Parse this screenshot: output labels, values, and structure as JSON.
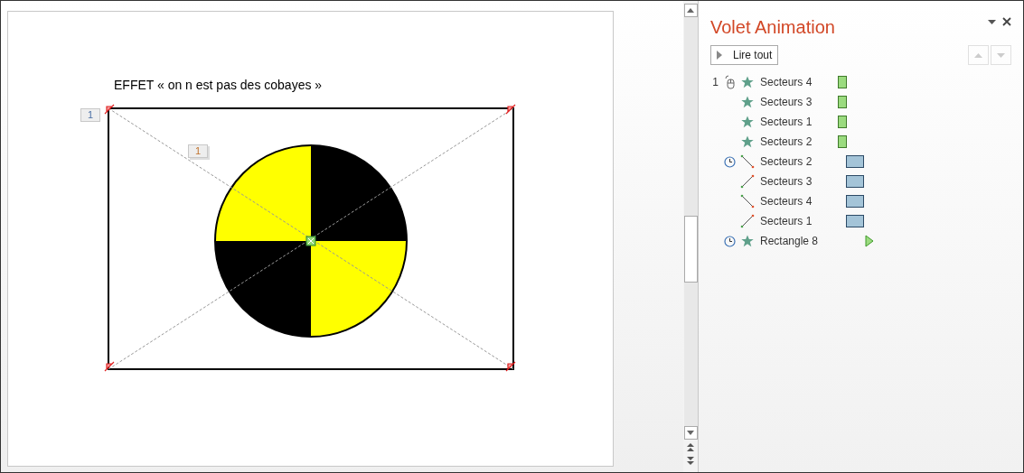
{
  "slide": {
    "title": "EFFET  « on n est pas des cobayes »",
    "trigger_badge": "1",
    "effect_badge": "1"
  },
  "pane": {
    "title": "Volet Animation",
    "play_button": "Lire tout",
    "items": [
      {
        "number": "1",
        "trigger": {
          "kind": "click"
        },
        "effect": {
          "kind": "emphasis"
        },
        "name": "Secteurs 4",
        "timing": {
          "kind": "short"
        }
      },
      {
        "effect": {
          "kind": "emphasis"
        },
        "name": "Secteurs 3",
        "timing": {
          "kind": "short"
        }
      },
      {
        "effect": {
          "kind": "emphasis"
        },
        "name": "Secteurs 1",
        "timing": {
          "kind": "short"
        }
      },
      {
        "effect": {
          "kind": "emphasis"
        },
        "name": "Secteurs 2",
        "timing": {
          "kind": "short"
        }
      },
      {
        "trigger": {
          "kind": "clock"
        },
        "effect": {
          "kind": "path-down"
        },
        "name": "Secteurs 2",
        "timing": {
          "kind": "long"
        }
      },
      {
        "effect": {
          "kind": "path-up"
        },
        "name": "Secteurs 3",
        "timing": {
          "kind": "long"
        }
      },
      {
        "effect": {
          "kind": "path-down"
        },
        "name": "Secteurs 4",
        "timing": {
          "kind": "long"
        }
      },
      {
        "effect": {
          "kind": "path-up"
        },
        "name": "Secteurs 1",
        "timing": {
          "kind": "long"
        }
      },
      {
        "trigger": {
          "kind": "clock"
        },
        "effect": {
          "kind": "emphasis"
        },
        "name": "Rectangle 8",
        "timing": {
          "kind": "arrow"
        }
      }
    ]
  }
}
